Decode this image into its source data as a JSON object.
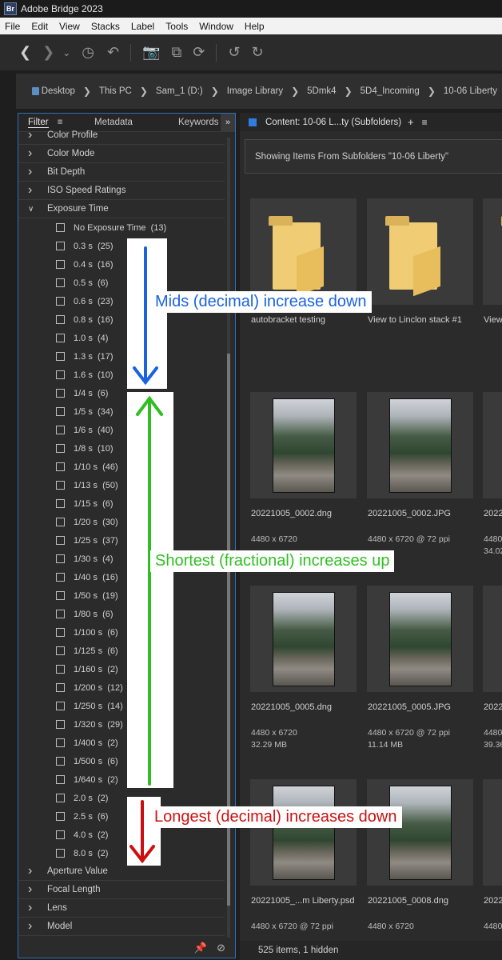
{
  "window": {
    "app_badge": "Br",
    "title": "Adobe Bridge 2023"
  },
  "menu": [
    "File",
    "Edit",
    "View",
    "Stacks",
    "Label",
    "Tools",
    "Window",
    "Help"
  ],
  "path": [
    "Desktop",
    "This PC",
    "Sam_1 (D:)",
    "Image Library",
    "5Dmk4",
    "5D4_Incoming",
    "10-06 Liberty"
  ],
  "panel_tabs": {
    "filter": "Filter",
    "metadata": "Metadata",
    "keywords": "Keywords"
  },
  "filter_categories_top": [
    "Color Profile",
    "Color Mode",
    "Bit Depth",
    "ISO Speed Ratings"
  ],
  "exposure_category": "Exposure Time",
  "exposure_options": [
    "No Exposure Time  (13)",
    "0.3 s  (25)",
    "0.4 s  (16)",
    "0.5 s  (6)",
    "0.6 s  (23)",
    "0.8 s  (16)",
    "1.0 s  (4)",
    "1.3 s  (17)",
    "1.6 s  (10)",
    "1/4 s  (6)",
    "1/5 s  (34)",
    "1/6 s  (40)",
    "1/8 s  (10)",
    "1/10 s  (46)",
    "1/13 s  (50)",
    "1/15 s  (6)",
    "1/20 s  (30)",
    "1/25 s  (37)",
    "1/30 s  (4)",
    "1/40 s  (16)",
    "1/50 s  (19)",
    "1/80 s  (6)",
    "1/100 s  (6)",
    "1/125 s  (6)",
    "1/160 s  (2)",
    "1/200 s  (12)",
    "1/250 s  (14)",
    "1/320 s  (29)",
    "1/400 s  (2)",
    "1/500 s  (6)",
    "1/640 s  (2)",
    "2.0 s  (2)",
    "2.5 s  (6)",
    "4.0 s  (2)",
    "8.0 s  (2)"
  ],
  "filter_categories_bottom": [
    "Aperture Value",
    "Focal Length",
    "Lens",
    "Model"
  ],
  "content": {
    "tab_label": "Content: 10-06 L...ty (Subfolders)",
    "subfolder_info": "Showing Items From Subfolders \"10-06 Liberty\"",
    "status": "525 items, 1 hidden",
    "items": [
      {
        "name": "autobracket testing",
        "meta1": "",
        "meta2": ""
      },
      {
        "name": "View to Linclon stack #1",
        "meta1": "",
        "meta2": ""
      },
      {
        "name": "View",
        "meta1": "",
        "meta2": ""
      },
      {
        "name": "20221005_0002.dng",
        "meta1": "4480 x 6720",
        "meta2": ""
      },
      {
        "name": "20221005_0002.JPG",
        "meta1": "4480 x 6720 @ 72 ppi",
        "meta2": ""
      },
      {
        "name": "2022",
        "meta1": "4480",
        "meta2": "34.02"
      },
      {
        "name": "20221005_0005.dng",
        "meta1": "4480 x 6720",
        "meta2": "32.29 MB"
      },
      {
        "name": "20221005_0005.JPG",
        "meta1": "4480 x 6720 @ 72 ppi",
        "meta2": "11.14 MB"
      },
      {
        "name": "2022",
        "meta1": "4480",
        "meta2": "39.36"
      },
      {
        "name": "20221005_...m Liberty.psd",
        "meta1": "4480 x 6720 @ 72 ppi",
        "meta2": ""
      },
      {
        "name": "20221005_0008.dng",
        "meta1": "4480 x 6720",
        "meta2": ""
      },
      {
        "name": "2022",
        "meta1": "4480",
        "meta2": ""
      }
    ]
  },
  "annotations": {
    "mids": "Mids (decimal) increase down",
    "shortest": "Shortest (fractional) increases up",
    "longest": "Longest (decimal) increases down",
    "colors": {
      "mids": "#1a63e0",
      "shortest": "#2fbf22",
      "longest": "#cc1010"
    }
  }
}
